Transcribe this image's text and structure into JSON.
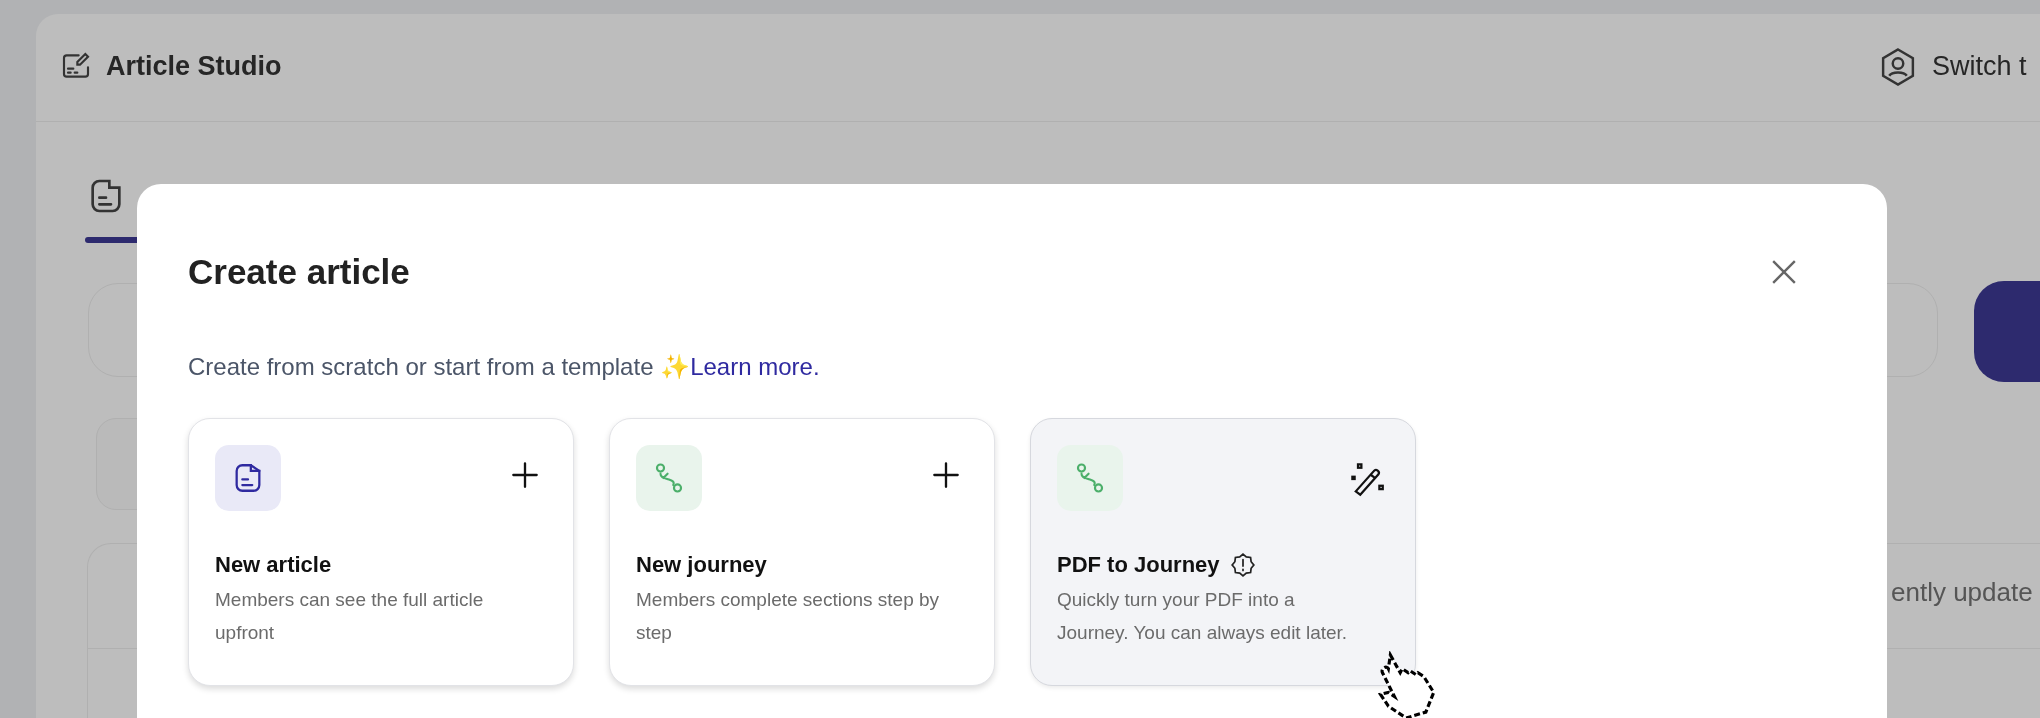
{
  "app": {
    "title": "Article Studio",
    "switch_label": "Switch t"
  },
  "background": {
    "tab_active": true,
    "table_header": "ently update"
  },
  "dialog": {
    "title": "Create article",
    "subtitle": "Create from scratch or start from a template ✨",
    "link": "Learn more.",
    "cards": [
      {
        "kind": "article",
        "magic_action": false,
        "title": "New article",
        "info_badge": false,
        "description": "Members can see the full article upfront",
        "hovered": false
      },
      {
        "kind": "journey",
        "magic_action": false,
        "title": "New journey",
        "info_badge": false,
        "description": "Members complete sections step by step",
        "hovered": false
      },
      {
        "kind": "journey",
        "magic_action": true,
        "title": "PDF to Journey",
        "info_badge": true,
        "description": "Quickly turn your PDF into a Journey. You can always edit later.",
        "hovered": true
      }
    ]
  }
}
